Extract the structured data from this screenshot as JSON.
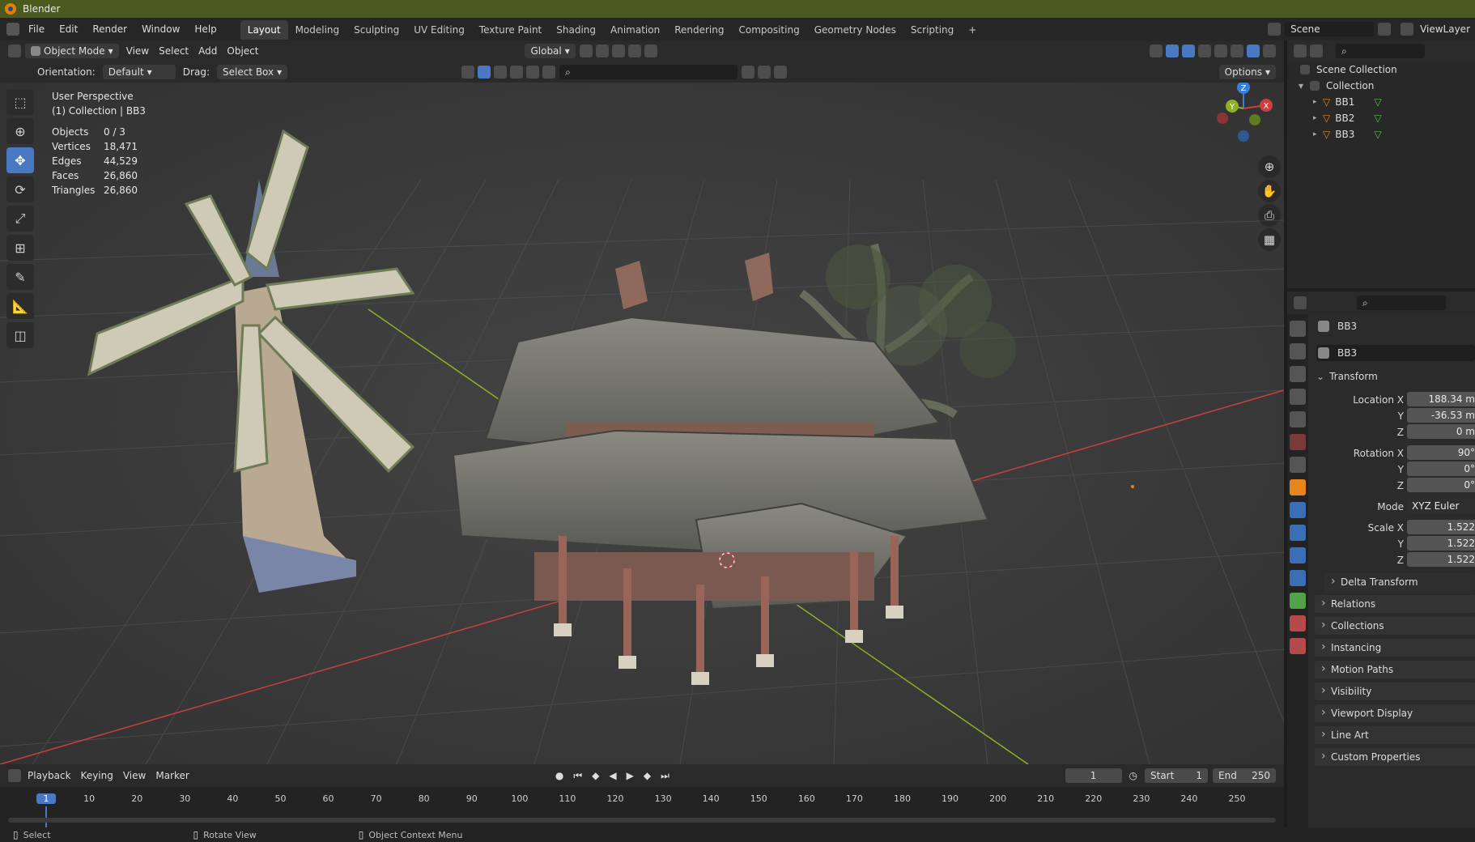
{
  "window": {
    "title": "Blender"
  },
  "menus": [
    "File",
    "Edit",
    "Render",
    "Window",
    "Help"
  ],
  "workspaces": [
    "Layout",
    "Modeling",
    "Sculpting",
    "UV Editing",
    "Texture Paint",
    "Shading",
    "Animation",
    "Rendering",
    "Compositing",
    "Geometry Nodes",
    "Scripting"
  ],
  "active_workspace": "Layout",
  "scene": {
    "name": "Scene",
    "view_layer": "ViewLayer"
  },
  "viewport_header": {
    "mode": "Object Mode",
    "menus": [
      "View",
      "Select",
      "Add",
      "Object"
    ],
    "transform_orientation": "Global",
    "orientation_label": "Orientation:",
    "orientation_value": "Default",
    "drag_label": "Drag:",
    "drag_value": "Select Box",
    "options_label": "Options"
  },
  "viewport_overlay": {
    "view_name": "User Perspective",
    "collection_line": "(1) Collection | BB3",
    "stats": [
      {
        "label": "Objects",
        "value": "0 / 3"
      },
      {
        "label": "Vertices",
        "value": "18,471"
      },
      {
        "label": "Edges",
        "value": "44,529"
      },
      {
        "label": "Faces",
        "value": "26,860"
      },
      {
        "label": "Triangles",
        "value": "26,860"
      }
    ]
  },
  "gizmo_axes": {
    "x": "X",
    "y": "Y",
    "z": "Z"
  },
  "outliner": {
    "root": "Scene Collection",
    "collection": "Collection",
    "objects": [
      "BB1",
      "BB2",
      "BB3"
    ]
  },
  "properties": {
    "object_name": "BB3",
    "datablock_name": "BB3",
    "transform_label": "Transform",
    "location_label": "Location X",
    "location": [
      "188.34 m",
      "-36.53 m",
      "0 m"
    ],
    "rotation_label": "Rotation X",
    "rotation": [
      "90°",
      "0°",
      "0°"
    ],
    "mode_label": "Mode",
    "mode_value": "XYZ Euler",
    "scale_label": "Scale X",
    "scale": [
      "1.522",
      "1.522",
      "1.522"
    ],
    "axis_y": "Y",
    "axis_z": "Z",
    "delta_transform": "Delta Transform",
    "panels": [
      "Relations",
      "Collections",
      "Instancing",
      "Motion Paths",
      "Visibility",
      "Viewport Display",
      "Line Art",
      "Custom Properties"
    ]
  },
  "timeline": {
    "menus": [
      "Playback",
      "Keying",
      "View",
      "Marker"
    ],
    "current_frame": "1",
    "start_label": "Start",
    "start": "1",
    "end_label": "End",
    "end": "250",
    "ticks": [
      "1",
      "10",
      "20",
      "30",
      "40",
      "50",
      "60",
      "70",
      "80",
      "90",
      "100",
      "110",
      "120",
      "130",
      "140",
      "150",
      "160",
      "170",
      "180",
      "190",
      "200",
      "210",
      "220",
      "230",
      "240",
      "250"
    ]
  },
  "statusbar": {
    "select": "Select",
    "rotate": "Rotate View",
    "context": "Object Context Menu"
  },
  "colors": {
    "accent": "#4a79c4",
    "title_bar": "#4b5a1c",
    "x_axis": "#c9403f",
    "y_axis": "#8cb124",
    "z_axis": "#3a7fd6",
    "object_orange": "#e8841d"
  }
}
